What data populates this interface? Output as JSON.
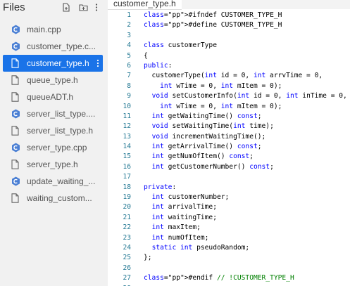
{
  "sidebar": {
    "title": "Files",
    "files": [
      {
        "name": "main.cpp",
        "icon": "cpp-file-icon",
        "active": false
      },
      {
        "name": "customer_type.c...",
        "icon": "cpp-file-icon",
        "active": false
      },
      {
        "name": "customer_type.h",
        "icon": "header-file-icon",
        "active": true
      },
      {
        "name": "queue_type.h",
        "icon": "header-file-icon",
        "active": false
      },
      {
        "name": "queueADT.h",
        "icon": "header-file-icon",
        "active": false
      },
      {
        "name": "server_list_type....",
        "icon": "cpp-file-icon",
        "active": false
      },
      {
        "name": "server_list_type.h",
        "icon": "header-file-icon",
        "active": false
      },
      {
        "name": "server_type.cpp",
        "icon": "cpp-file-icon",
        "active": false
      },
      {
        "name": "server_type.h",
        "icon": "header-file-icon",
        "active": false
      },
      {
        "name": "update_waiting_...",
        "icon": "cpp-file-icon",
        "active": false
      },
      {
        "name": "waiting_custom...",
        "icon": "header-file-icon",
        "active": false
      }
    ]
  },
  "editor": {
    "tab_label": "customer_type.h",
    "lines": [
      {
        "n": "1",
        "code": "#ifndef CUSTOMER_TYPE_H"
      },
      {
        "n": "2",
        "code": "#define CUSTOMER_TYPE_H"
      },
      {
        "n": "3",
        "code": ""
      },
      {
        "n": "4",
        "code": "class customerType"
      },
      {
        "n": "5",
        "code": "{"
      },
      {
        "n": "6",
        "code": "public:"
      },
      {
        "n": "7",
        "code": "  customerType(int id = 0, int arrvTime = 0,"
      },
      {
        "n": "8",
        "code": "    int wTime = 0, int mItem = 0);"
      },
      {
        "n": "9",
        "code": "  void setCustomerInfo(int id = 0, int inTime = 0,"
      },
      {
        "n": "10",
        "code": "    int wTime = 0, int mItem = 0);"
      },
      {
        "n": "11",
        "code": "  int getWaitingTime() const;"
      },
      {
        "n": "12",
        "code": "  void setWaitingTime(int time);"
      },
      {
        "n": "13",
        "code": "  void incrementWaitingTime();"
      },
      {
        "n": "14",
        "code": "  int getArrivalTime() const;"
      },
      {
        "n": "15",
        "code": "  int getNumOfItem() const;"
      },
      {
        "n": "16",
        "code": "  int getCustomerNumber() const;"
      },
      {
        "n": "17",
        "code": ""
      },
      {
        "n": "18",
        "code": "private:"
      },
      {
        "n": "19",
        "code": "  int customerNumber;"
      },
      {
        "n": "20",
        "code": "  int arrivalTime;"
      },
      {
        "n": "21",
        "code": "  int waitingTime;"
      },
      {
        "n": "22",
        "code": "  int maxItem;"
      },
      {
        "n": "23",
        "code": "  int numOfItem;"
      },
      {
        "n": "24",
        "code": "  static int pseudoRandom;"
      },
      {
        "n": "25",
        "code": "};"
      },
      {
        "n": "26",
        "code": ""
      },
      {
        "n": "27",
        "code": "#endif // !CUSTOMER_TYPE_H"
      },
      {
        "n": "28",
        "code": ""
      }
    ]
  },
  "colors": {
    "active_bg": "#1a73e8",
    "cpp_icon": "#4a7fd4",
    "keyword": "#0000ff",
    "comment": "#008000",
    "line_number": "#237893"
  }
}
